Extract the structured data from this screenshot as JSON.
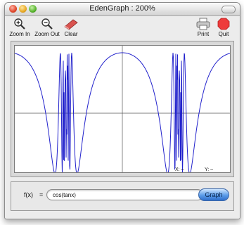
{
  "window": {
    "title": "EdenGraph : 200%"
  },
  "toolbar": {
    "zoom_in": {
      "label": "Zoom In",
      "icon": "magnifier-plus-icon"
    },
    "zoom_out": {
      "label": "Zoom Out",
      "icon": "magnifier-minus-icon"
    },
    "clear": {
      "label": "Clear",
      "icon": "eraser-icon"
    },
    "print": {
      "label": "Print",
      "icon": "printer-icon"
    },
    "quit": {
      "label": "Quit",
      "icon": "stop-icon"
    }
  },
  "plot": {
    "x_readout": "X: –",
    "y_readout": "Y: –",
    "curve_color": "#2222cc"
  },
  "formula": {
    "label": "f(x)",
    "equals": "=",
    "value": "cos(tanx)",
    "graph_button": "Graph"
  }
}
